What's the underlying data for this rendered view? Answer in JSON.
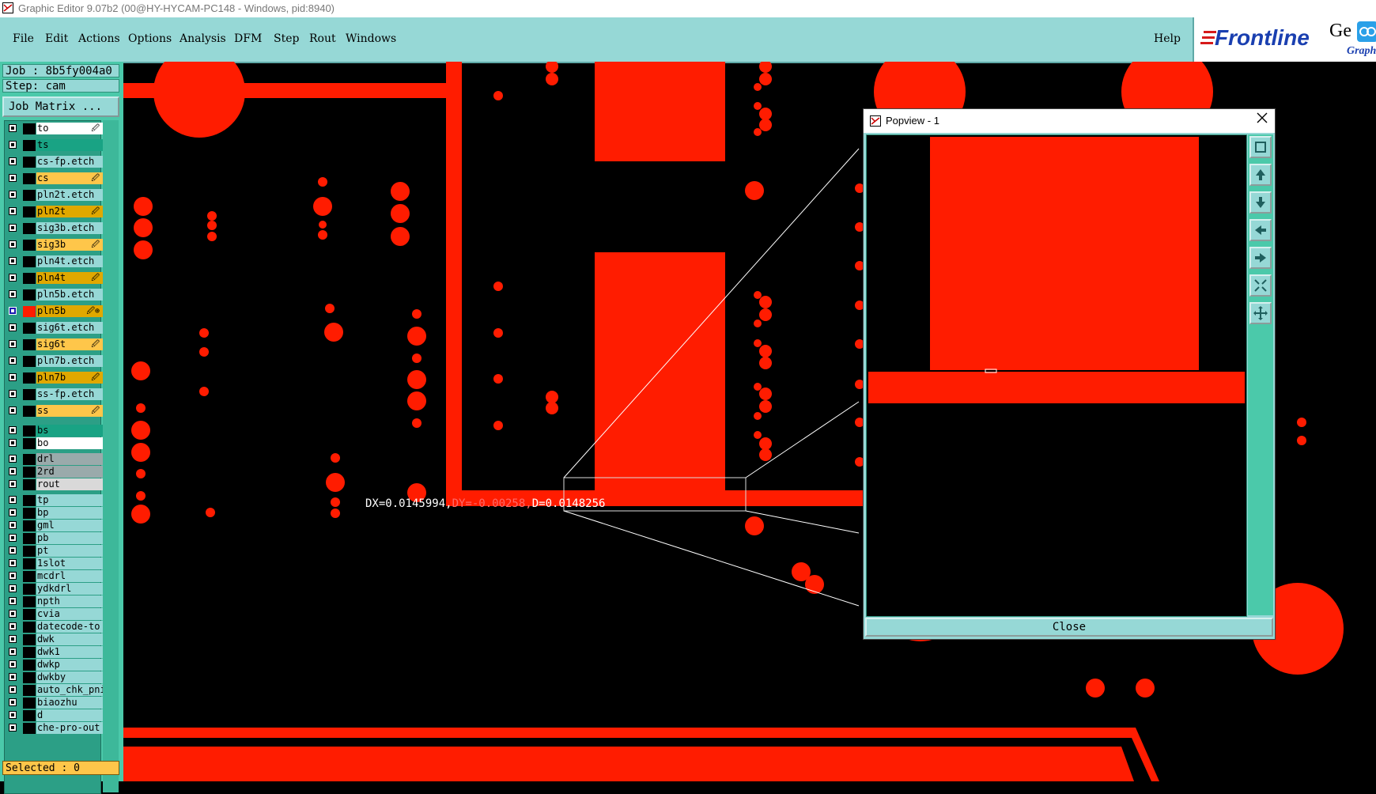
{
  "window": {
    "title": "Graphic Editor 9.07b2 (00@HY-HYCAM-PC148 - Windows, pid:8940)"
  },
  "menu": [
    "File",
    "Edit",
    "Actions",
    "Options",
    "Analysis",
    "DFM",
    "Step",
    "Rout",
    "Windows"
  ],
  "help_label": "Help",
  "logo": {
    "brand": "Frontline",
    "tail": "Ge",
    "sub": "Graph"
  },
  "job": {
    "job_line": "Job : 8b5fy004a0",
    "step_line": "Step: cam",
    "matrix_label": "Job Matrix ..."
  },
  "layers": [
    {
      "name": "to",
      "bg": "#ffffff",
      "mark": "🖉",
      "checked": false
    },
    {
      "name": "ts",
      "bg": "#19a384",
      "mark": "",
      "checked": false
    },
    {
      "name": "cs-fp.etch",
      "bg": "#96d8d6",
      "mark": "",
      "checked": false
    },
    {
      "name": "cs",
      "bg": "#fec64a",
      "mark": "🖉",
      "checked": false
    },
    {
      "name": "pln2t.etch",
      "bg": "#96d8d6",
      "mark": "",
      "checked": false
    },
    {
      "name": "pln2t",
      "bg": "#e0a800",
      "mark": "🖉",
      "checked": false
    },
    {
      "name": "sig3b.etch",
      "bg": "#96d8d6",
      "mark": "",
      "checked": false
    },
    {
      "name": "sig3b",
      "bg": "#fec64a",
      "mark": "🖉",
      "checked": false
    },
    {
      "name": "pln4t.etch",
      "bg": "#96d8d6",
      "mark": "",
      "checked": false
    },
    {
      "name": "pln4t",
      "bg": "#e0a800",
      "mark": "🖉",
      "checked": false
    },
    {
      "name": "pln5b.etch",
      "bg": "#96d8d6",
      "mark": "",
      "checked": false
    },
    {
      "name": "pln5b",
      "bg": "#e0a800",
      "mark": "🖉⊕",
      "checked": true,
      "swatch": true
    },
    {
      "name": "sig6t.etch",
      "bg": "#96d8d6",
      "mark": "",
      "checked": false
    },
    {
      "name": "sig6t",
      "bg": "#fec64a",
      "mark": "🖉",
      "checked": false
    },
    {
      "name": "pln7b.etch",
      "bg": "#96d8d6",
      "mark": "",
      "checked": false
    },
    {
      "name": "pln7b",
      "bg": "#e0a800",
      "mark": "🖉",
      "checked": false
    },
    {
      "name": "ss-fp.etch",
      "bg": "#96d8d6",
      "mark": "",
      "checked": false
    },
    {
      "name": "ss",
      "bg": "#fec64a",
      "mark": "🖉",
      "checked": false
    },
    {
      "name": "bs",
      "bg": "#19a384",
      "mark": "",
      "checked": false
    },
    {
      "name": "bo",
      "bg": "#ffffff",
      "mark": "",
      "checked": false
    },
    {
      "name": "drl",
      "bg": "#9aaaab",
      "mark": "",
      "checked": false
    },
    {
      "name": "2rd",
      "bg": "#9aaaab",
      "mark": "",
      "checked": false
    },
    {
      "name": "rout",
      "bg": "#d9d9d9",
      "mark": "",
      "checked": false
    },
    {
      "name": "tp",
      "bg": "#96d8d6",
      "mark": "",
      "checked": false
    },
    {
      "name": "bp",
      "bg": "#96d8d6",
      "mark": "",
      "checked": false
    },
    {
      "name": "gml",
      "bg": "#96d8d6",
      "mark": "",
      "checked": false
    },
    {
      "name": "pb",
      "bg": "#96d8d6",
      "mark": "",
      "checked": false
    },
    {
      "name": "pt",
      "bg": "#96d8d6",
      "mark": "",
      "checked": false
    },
    {
      "name": "1slot",
      "bg": "#96d8d6",
      "mark": "",
      "checked": false
    },
    {
      "name": "mcdrl",
      "bg": "#96d8d6",
      "mark": "",
      "checked": false
    },
    {
      "name": "ydkdrl",
      "bg": "#96d8d6",
      "mark": "",
      "checked": false
    },
    {
      "name": "npth",
      "bg": "#96d8d6",
      "mark": "",
      "checked": false
    },
    {
      "name": "cvia",
      "bg": "#96d8d6",
      "mark": "",
      "checked": false
    },
    {
      "name": "datecode-to",
      "bg": "#96d8d6",
      "mark": "",
      "checked": false
    },
    {
      "name": "dwk",
      "bg": "#96d8d6",
      "mark": "",
      "checked": false
    },
    {
      "name": "dwk1",
      "bg": "#96d8d6",
      "mark": "",
      "checked": false
    },
    {
      "name": "dwkp",
      "bg": "#96d8d6",
      "mark": "",
      "checked": false
    },
    {
      "name": "dwkby",
      "bg": "#96d8d6",
      "mark": "",
      "checked": false
    },
    {
      "name": "auto_chk_pni",
      "bg": "#96d8d6",
      "mark": "",
      "checked": false
    },
    {
      "name": "biaozhu",
      "bg": "#96d8d6",
      "mark": "",
      "checked": false
    },
    {
      "name": "d",
      "bg": "#96d8d6",
      "mark": "",
      "checked": false
    },
    {
      "name": "che-pro-out",
      "bg": "#96d8d6",
      "mark": "",
      "checked": false
    }
  ],
  "selected_label": "Selected : 0",
  "measure": {
    "dx": "DX=0.0145994,",
    "dy": "DY=-0.00258,",
    "d": "D=0.0148256"
  },
  "popview": {
    "title": "Popview - 1",
    "close_label": "Close",
    "close_icon": "close-icon"
  },
  "colors": {
    "feature": "#ff1c00",
    "panel": "#96d8d6",
    "panel_dark": "#4bc9aa",
    "background": "#000000"
  }
}
